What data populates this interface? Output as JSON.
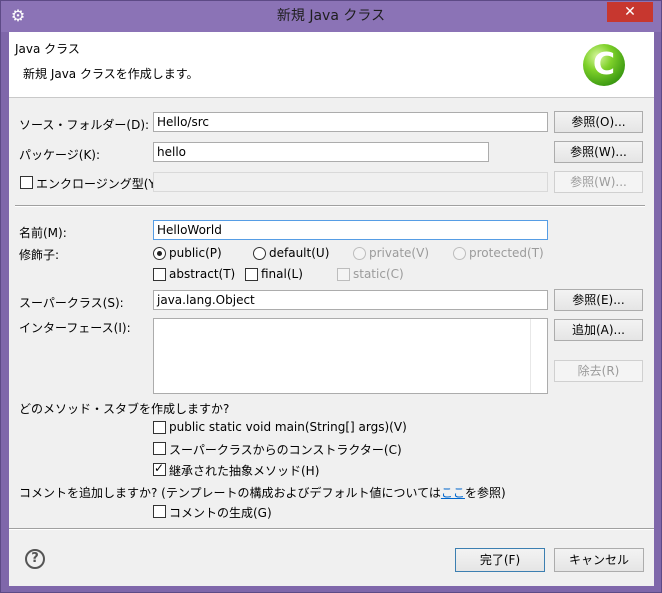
{
  "window": {
    "title": "新規 Java クラス",
    "close_glyph": "✕",
    "sys_glyph": "⚙"
  },
  "banner": {
    "title": "Java クラス",
    "description": "新規 Java クラスを作成します。",
    "logo_letter": "C"
  },
  "source_folder": {
    "label": "ソース・フォルダー(D):",
    "value": "Hello/src",
    "browse": "参照(O)..."
  },
  "package": {
    "label": "パッケージ(K):",
    "value": "hello",
    "browse": "参照(W)..."
  },
  "enclosing": {
    "label": "エンクロージング型(Y):",
    "value": "",
    "browse": "参照(W)..."
  },
  "name": {
    "label": "名前(M):",
    "value": "HelloWorld"
  },
  "modifiers": {
    "label": "修飾子:",
    "public": "public(P)",
    "default": "default(U)",
    "private": "private(V)",
    "protected": "protected(T)",
    "abstract": "abstract(T)",
    "final": "final(L)",
    "static": "static(C)"
  },
  "superclass": {
    "label": "スーパークラス(S):",
    "value": "java.lang.Object",
    "browse": "参照(E)..."
  },
  "interfaces": {
    "label": "インターフェース(I):",
    "add": "追加(A)...",
    "remove": "除去(R)"
  },
  "stubs": {
    "question": "どのメソッド・スタブを作成しますか?",
    "main": "public static void main(String[] args)(V)",
    "constructors": "スーパークラスからのコンストラクター(C)",
    "inherited": "継承された抽象メソッド(H)"
  },
  "comments": {
    "question_prefix": "コメントを追加しますか? (テンプレートの構成およびデフォルト値については",
    "link": "ここ",
    "question_suffix": "を参照)",
    "generate": "コメントの生成(G)"
  },
  "footer": {
    "help": "?",
    "finish": "完了(F)",
    "cancel": "キャンセル"
  }
}
